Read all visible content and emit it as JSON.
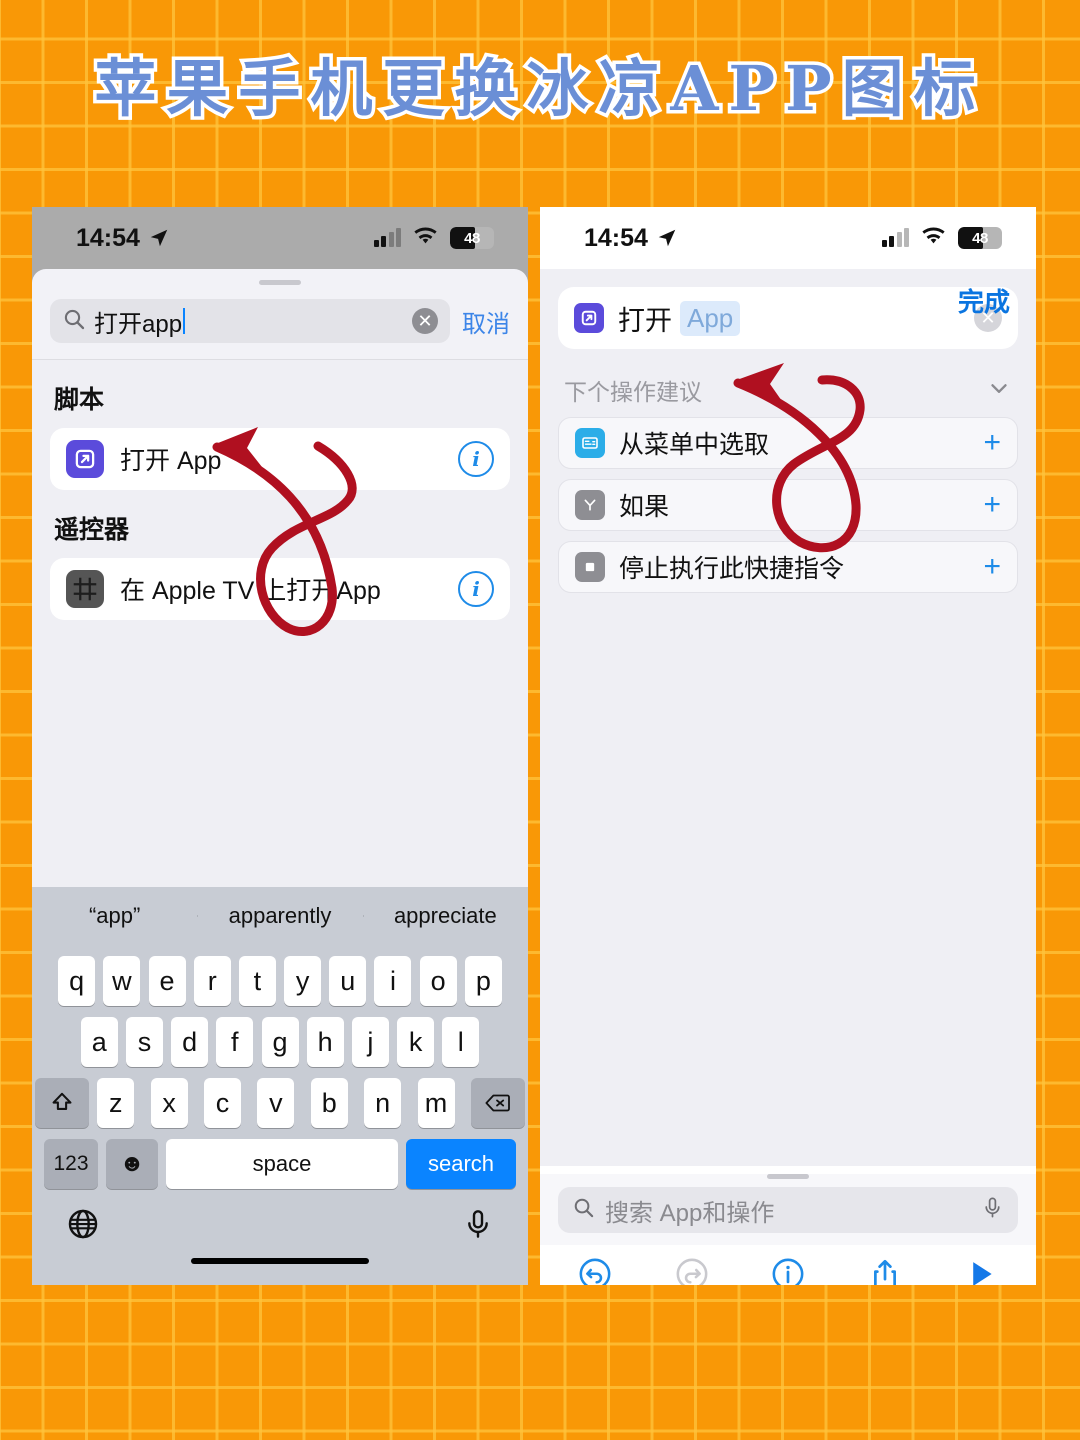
{
  "page": {
    "title": "苹果手机更换冰凉APP图标",
    "accent_orange": "#F99806",
    "title_blue": "#6B8FD6"
  },
  "left_phone": {
    "status": {
      "time": "14:54",
      "location_icon": "location-arrow-icon",
      "battery": "48"
    },
    "search": {
      "value": "打开app",
      "clear_icon": "clear-circle-icon",
      "cancel_label": "取消",
      "search_icon": "search-icon"
    },
    "sections": [
      {
        "title": "脚本",
        "rows": [
          {
            "label": "打开 App",
            "icon": "open-app-icon",
            "info": "info-icon"
          }
        ]
      },
      {
        "title": "遥控器",
        "rows": [
          {
            "label": "在 Apple TV 上打开App",
            "icon": "apple-tv-icon",
            "info": "info-icon"
          }
        ]
      }
    ],
    "keyboard": {
      "predictions": [
        "“app”",
        "apparently",
        "appreciate"
      ],
      "row1": [
        "q",
        "w",
        "e",
        "r",
        "t",
        "y",
        "u",
        "i",
        "o",
        "p"
      ],
      "row2": [
        "a",
        "s",
        "d",
        "f",
        "g",
        "h",
        "j",
        "k",
        "l"
      ],
      "row3": [
        "z",
        "x",
        "c",
        "v",
        "b",
        "n",
        "m"
      ],
      "shift_icon": "shift-icon",
      "backspace_icon": "backspace-icon",
      "numbers_label": "123",
      "emoji_icon": "emoji-icon",
      "space_label": "space",
      "search_label": "search",
      "globe_icon": "globe-icon",
      "mic_icon": "microphone-icon"
    }
  },
  "right_phone": {
    "status": {
      "time": "14:54",
      "location_icon": "location-arrow-icon",
      "battery": "48"
    },
    "nav": {
      "app_icon": "shortcuts-icon",
      "title": "打开 App",
      "chevron": "chevron-down-icon",
      "done_label": "完成"
    },
    "action": {
      "icon": "open-app-icon",
      "verb": "打开",
      "token": "App",
      "clear_icon": "clear-circle-icon"
    },
    "suggestions": {
      "header": "下个操作建议",
      "collapse_icon": "chevron-down-icon",
      "rows": [
        {
          "label": "从菜单中选取",
          "icon": "choose-from-menu-icon",
          "add": "+"
        },
        {
          "label": "如果",
          "icon": "if-icon",
          "add": "+"
        },
        {
          "label": "停止执行此快捷指令",
          "icon": "stop-shortcut-icon",
          "add": "+"
        }
      ]
    },
    "bottom_search": {
      "placeholder": "搜索 App和操作",
      "search_icon": "search-icon",
      "mic_icon": "microphone-icon"
    },
    "toolbar": [
      {
        "name": "undo-icon",
        "enabled": true
      },
      {
        "name": "redo-icon",
        "enabled": false
      },
      {
        "name": "info-icon",
        "enabled": true
      },
      {
        "name": "share-icon",
        "enabled": true
      },
      {
        "name": "play-icon",
        "enabled": true
      }
    ]
  }
}
